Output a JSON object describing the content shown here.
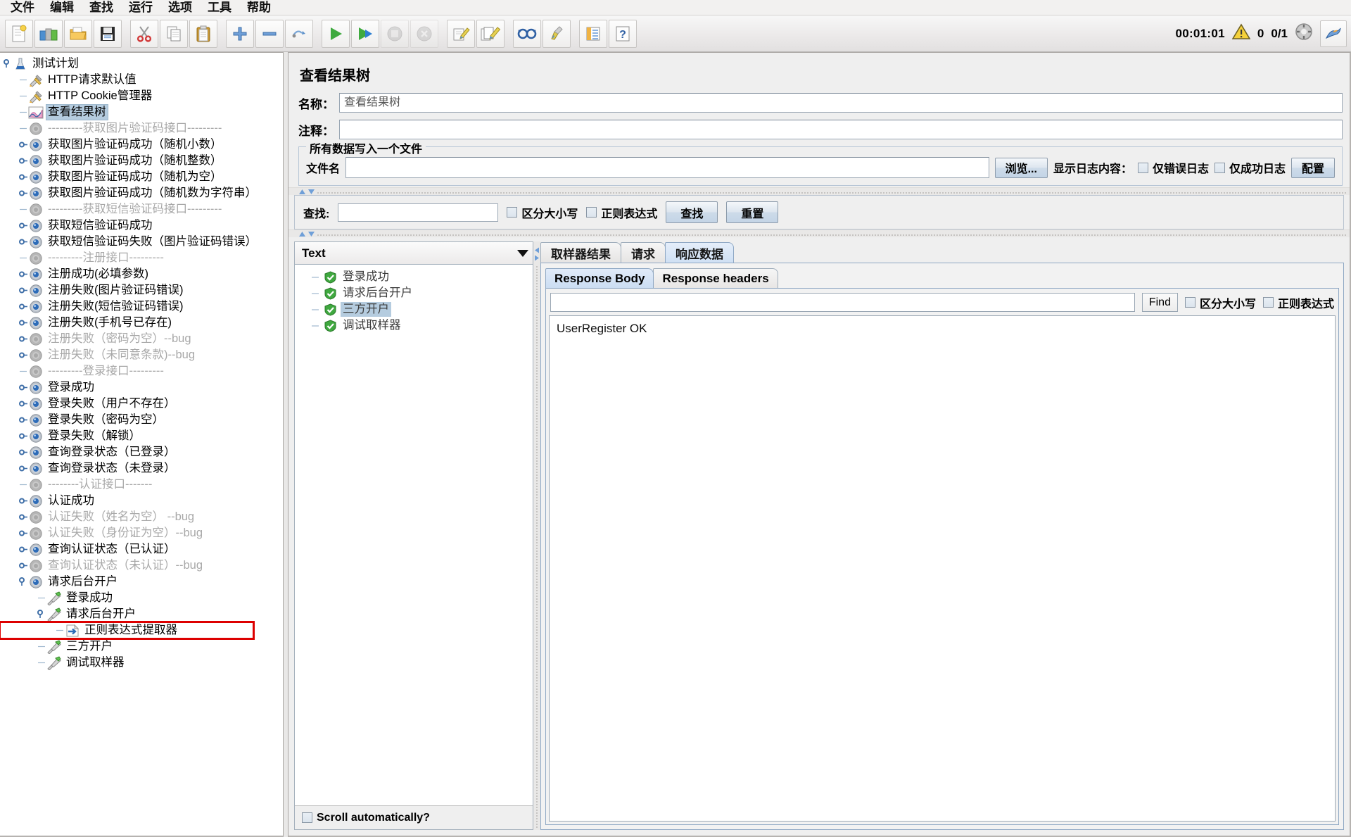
{
  "menu": {
    "items": [
      "文件",
      "编辑",
      "查找",
      "运行",
      "选项",
      "工具",
      "帮助"
    ]
  },
  "toolbar": {
    "buttons": [
      {
        "name": "new-icon",
        "title": "新建"
      },
      {
        "name": "templates-icon",
        "title": "模板"
      },
      {
        "name": "open-icon",
        "title": "打开"
      },
      {
        "name": "save-icon",
        "title": "保存"
      },
      {
        "name": "cut-icon",
        "title": "剪切"
      },
      {
        "name": "copy-icon",
        "title": "复制"
      },
      {
        "name": "paste-icon",
        "title": "粘贴"
      },
      {
        "name": "expand-icon",
        "title": "展开"
      },
      {
        "name": "collapse-icon",
        "title": "收起"
      },
      {
        "name": "toggle-icon",
        "title": "启用/禁用"
      },
      {
        "name": "start-icon",
        "title": "启动"
      },
      {
        "name": "start-no-pause-icon",
        "title": "无暂停启动"
      },
      {
        "name": "stop-icon",
        "title": "停止"
      },
      {
        "name": "shutdown-icon",
        "title": "关闭"
      },
      {
        "name": "clear-icon",
        "title": "清除"
      },
      {
        "name": "clear-all-icon",
        "title": "清除全部"
      },
      {
        "name": "search-icon",
        "title": "查找"
      },
      {
        "name": "reset-search-icon",
        "title": "重置查找"
      },
      {
        "name": "function-helper-icon",
        "title": "函数助手"
      },
      {
        "name": "help-icon",
        "title": "帮助"
      }
    ],
    "timer": "00:01:01",
    "warnings": "0",
    "threads": "0/1",
    "status_icons": [
      "warning-triangle-icon",
      "error-circle-icon",
      "jmeter-logo-icon"
    ]
  },
  "tree": {
    "nodes": [
      {
        "label": "测试计划",
        "indent": 0,
        "icon": "test-plan-icon",
        "handle": "expanded",
        "dim": false,
        "selected": false
      },
      {
        "label": "HTTP请求默认值",
        "indent": 1,
        "icon": "config-tools-icon",
        "handle": "none",
        "dim": false,
        "selected": false
      },
      {
        "label": "HTTP Cookie管理器",
        "indent": 1,
        "icon": "config-tools-icon",
        "handle": "none",
        "dim": false,
        "selected": false
      },
      {
        "label": "查看结果树",
        "indent": 1,
        "icon": "view-results-tree-icon",
        "handle": "none",
        "dim": false,
        "selected": true
      },
      {
        "label": "---------获取图片验证码接口---------",
        "indent": 1,
        "icon": "thread-group-gray-icon",
        "handle": "none",
        "dim": true,
        "selected": false
      },
      {
        "label": "获取图片验证码成功（随机小数）",
        "indent": 1,
        "icon": "thread-group-icon",
        "handle": "collapsed",
        "dim": false,
        "selected": false
      },
      {
        "label": "获取图片验证码成功（随机整数）",
        "indent": 1,
        "icon": "thread-group-icon",
        "handle": "collapsed",
        "dim": false,
        "selected": false
      },
      {
        "label": "获取图片验证码成功（随机为空）",
        "indent": 1,
        "icon": "thread-group-icon",
        "handle": "collapsed",
        "dim": false,
        "selected": false
      },
      {
        "label": "获取图片验证码成功（随机数为字符串）",
        "indent": 1,
        "icon": "thread-group-icon",
        "handle": "collapsed",
        "dim": false,
        "selected": false
      },
      {
        "label": "---------获取短信验证码接口---------",
        "indent": 1,
        "icon": "thread-group-gray-icon",
        "handle": "none",
        "dim": true,
        "selected": false
      },
      {
        "label": "获取短信验证码成功",
        "indent": 1,
        "icon": "thread-group-icon",
        "handle": "collapsed",
        "dim": false,
        "selected": false
      },
      {
        "label": "获取短信验证码失败（图片验证码错误）",
        "indent": 1,
        "icon": "thread-group-icon",
        "handle": "collapsed",
        "dim": false,
        "selected": false
      },
      {
        "label": "---------注册接口---------",
        "indent": 1,
        "icon": "thread-group-gray-icon",
        "handle": "none",
        "dim": true,
        "selected": false
      },
      {
        "label": "注册成功(必填参数)",
        "indent": 1,
        "icon": "thread-group-icon",
        "handle": "collapsed",
        "dim": false,
        "selected": false
      },
      {
        "label": "注册失败(图片验证码错误)",
        "indent": 1,
        "icon": "thread-group-icon",
        "handle": "collapsed",
        "dim": false,
        "selected": false
      },
      {
        "label": "注册失败(短信验证码错误)",
        "indent": 1,
        "icon": "thread-group-icon",
        "handle": "collapsed",
        "dim": false,
        "selected": false
      },
      {
        "label": "注册失败(手机号已存在)",
        "indent": 1,
        "icon": "thread-group-icon",
        "handle": "collapsed",
        "dim": false,
        "selected": false
      },
      {
        "label": "注册失败（密码为空）--bug",
        "indent": 1,
        "icon": "thread-group-gray-icon",
        "handle": "collapsed",
        "dim": true,
        "selected": false
      },
      {
        "label": "注册失败（未同意条款)--bug",
        "indent": 1,
        "icon": "thread-group-gray-icon",
        "handle": "collapsed",
        "dim": true,
        "selected": false
      },
      {
        "label": "---------登录接口---------",
        "indent": 1,
        "icon": "thread-group-gray-icon",
        "handle": "none",
        "dim": true,
        "selected": false
      },
      {
        "label": "登录成功",
        "indent": 1,
        "icon": "thread-group-icon",
        "handle": "collapsed",
        "dim": false,
        "selected": false
      },
      {
        "label": "登录失败（用户不存在）",
        "indent": 1,
        "icon": "thread-group-icon",
        "handle": "collapsed",
        "dim": false,
        "selected": false
      },
      {
        "label": "登录失败（密码为空）",
        "indent": 1,
        "icon": "thread-group-icon",
        "handle": "collapsed",
        "dim": false,
        "selected": false
      },
      {
        "label": "登录失败（解锁）",
        "indent": 1,
        "icon": "thread-group-icon",
        "handle": "collapsed",
        "dim": false,
        "selected": false
      },
      {
        "label": "查询登录状态（已登录）",
        "indent": 1,
        "icon": "thread-group-icon",
        "handle": "collapsed",
        "dim": false,
        "selected": false
      },
      {
        "label": "查询登录状态（未登录）",
        "indent": 1,
        "icon": "thread-group-icon",
        "handle": "collapsed",
        "dim": false,
        "selected": false
      },
      {
        "label": "--------认证接口-------",
        "indent": 1,
        "icon": "thread-group-gray-icon",
        "handle": "none",
        "dim": true,
        "selected": false
      },
      {
        "label": "认证成功",
        "indent": 1,
        "icon": "thread-group-icon",
        "handle": "collapsed",
        "dim": false,
        "selected": false
      },
      {
        "label": "认证失败（姓名为空） --bug",
        "indent": 1,
        "icon": "thread-group-gray-icon",
        "handle": "collapsed",
        "dim": true,
        "selected": false
      },
      {
        "label": "认证失败（身份证为空）--bug",
        "indent": 1,
        "icon": "thread-group-gray-icon",
        "handle": "collapsed",
        "dim": true,
        "selected": false
      },
      {
        "label": "查询认证状态（已认证）",
        "indent": 1,
        "icon": "thread-group-icon",
        "handle": "collapsed",
        "dim": false,
        "selected": false
      },
      {
        "label": "查询认证状态（未认证）--bug",
        "indent": 1,
        "icon": "thread-group-gray-icon",
        "handle": "collapsed",
        "dim": true,
        "selected": false
      },
      {
        "label": "请求后台开户",
        "indent": 1,
        "icon": "thread-group-icon",
        "handle": "expanded",
        "dim": false,
        "selected": false
      },
      {
        "label": "登录成功",
        "indent": 2,
        "icon": "http-sampler-icon",
        "handle": "none",
        "dim": false,
        "selected": false
      },
      {
        "label": "请求后台开户",
        "indent": 2,
        "icon": "http-sampler-icon",
        "handle": "expanded",
        "dim": false,
        "selected": false
      },
      {
        "label": "正则表达式提取器",
        "indent": 3,
        "icon": "regex-extractor-icon",
        "handle": "none",
        "dim": false,
        "selected": false,
        "boxed": true
      },
      {
        "label": "三方开户",
        "indent": 2,
        "icon": "http-sampler-icon",
        "handle": "none",
        "dim": false,
        "selected": false
      },
      {
        "label": "调试取样器",
        "indent": 2,
        "icon": "http-sampler-icon",
        "handle": "none",
        "dim": false,
        "selected": false
      }
    ]
  },
  "panel": {
    "title": "查看结果树",
    "name_label": "名称：",
    "name_value": "查看结果树",
    "comment_label": "注释：",
    "comment_value": "",
    "filegroup": {
      "title": "所有数据写入一个文件",
      "filename_label": "文件名",
      "filename_value": "",
      "browse_button": "浏览...",
      "log_display_label": "显示日志内容：",
      "errors_only": "仅错误日志",
      "success_only": "仅成功日志",
      "configure_button": "配置"
    },
    "search": {
      "label": "查找:",
      "value": "",
      "case_sensitive": "区分大小写",
      "regex": "正则表达式",
      "find_button": "查找",
      "reset_button": "重置"
    },
    "results": {
      "renderer_selected": "Text",
      "items": [
        {
          "label": "登录成功",
          "status": "success",
          "selected": false
        },
        {
          "label": "请求后台开户",
          "status": "success",
          "selected": false
        },
        {
          "label": "三方开户",
          "status": "success",
          "selected": true
        },
        {
          "label": "调试取样器",
          "status": "success",
          "selected": false
        }
      ],
      "scroll_auto_label": "Scroll automatically?",
      "scroll_auto_checked": false
    },
    "detail": {
      "tabs": [
        {
          "label": "取样器结果",
          "active": false
        },
        {
          "label": "请求",
          "active": false
        },
        {
          "label": "响应数据",
          "active": true
        }
      ],
      "subtabs": [
        {
          "label": "Response Body",
          "active": true
        },
        {
          "label": "Response headers",
          "active": false
        }
      ],
      "find_value": "",
      "find_button": "Find",
      "case_sensitive": "区分大小写",
      "regex": "正则表达式",
      "response_body": "UserRegister OK"
    }
  },
  "colors": {
    "selection": "#b5ccdf",
    "highlight_box": "#dd0000",
    "accent": "#3f6fa8",
    "success": "#35a043"
  }
}
